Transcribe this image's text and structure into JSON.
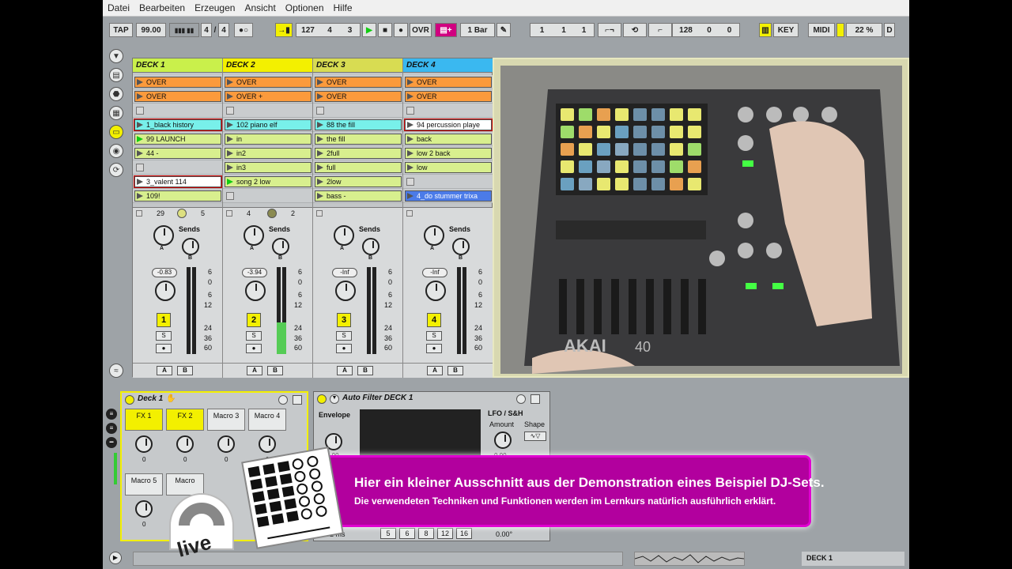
{
  "menu": [
    "Datei",
    "Bearbeiten",
    "Erzeugen",
    "Ansicht",
    "Optionen",
    "Hilfe"
  ],
  "control_bar": {
    "tap": "TAP",
    "tempo": "99.00",
    "signature_num": "4",
    "signature_den": "4",
    "position_bar": "127",
    "position_beat": "4",
    "position_sixteenth": "3",
    "ovr": "OVR",
    "quantize": "1 Bar",
    "loop_start_bar": "1",
    "loop_start_beat": "1",
    "loop_start_sixteenth": "1",
    "loop_len_bar": "128",
    "loop_len_beat": "0",
    "loop_len_sixteenth": "0",
    "key": "KEY",
    "midi": "MIDI",
    "cpu": "22 %",
    "d": "D"
  },
  "tracks": [
    {
      "name": "DECK 1",
      "color": "#c9f04b",
      "volume": "-0.83",
      "number": "1",
      "send_a": "29",
      "send_b": "5",
      "clips": [
        {
          "label": "OVER",
          "type": "orange"
        },
        {
          "label": "OVER",
          "type": "orange"
        },
        {
          "label": "",
          "type": "stop"
        },
        {
          "label": "1_black history",
          "type": "cyan"
        },
        {
          "label": "99 LAUNCH",
          "type": "green",
          "playing": true
        },
        {
          "label": "44 -",
          "type": "green"
        },
        {
          "label": "",
          "type": "stop"
        },
        {
          "label": "3_valent 114",
          "type": "white"
        },
        {
          "label": "109!",
          "type": "green"
        }
      ]
    },
    {
      "name": "DECK 2",
      "color": "#f3f000",
      "volume": "-3.94",
      "number": "2",
      "send_a": "4",
      "send_b": "2",
      "clips": [
        {
          "label": "OVER",
          "type": "orange"
        },
        {
          "label": "OVER +",
          "type": "orange"
        },
        {
          "label": "",
          "type": "stop"
        },
        {
          "label": "102 piano elf",
          "type": "cyan"
        },
        {
          "label": "in",
          "type": "green"
        },
        {
          "label": "in2",
          "type": "green"
        },
        {
          "label": "in3",
          "type": "green"
        },
        {
          "label": "song 2 low",
          "type": "green",
          "playing": true
        },
        {
          "label": "",
          "type": "stop"
        }
      ]
    },
    {
      "name": "DECK 3",
      "color": "#d8dc52",
      "volume": "-Inf",
      "number": "3",
      "send_a": "",
      "send_b": "",
      "clips": [
        {
          "label": "OVER",
          "type": "orange"
        },
        {
          "label": "OVER",
          "type": "orange"
        },
        {
          "label": "",
          "type": "stop"
        },
        {
          "label": "88 the fill",
          "type": "cyan"
        },
        {
          "label": "the fill",
          "type": "green"
        },
        {
          "label": "2full",
          "type": "green"
        },
        {
          "label": "full",
          "type": "green"
        },
        {
          "label": "2low",
          "type": "green"
        },
        {
          "label": "bass -",
          "type": "green"
        }
      ]
    },
    {
      "name": "DECK 4",
      "color": "#3ab8f0",
      "volume": "-Inf",
      "number": "4",
      "send_a": "",
      "send_b": "",
      "clips": [
        {
          "label": "OVER",
          "type": "orange"
        },
        {
          "label": "OVER",
          "type": "orange"
        },
        {
          "label": "",
          "type": "stop"
        },
        {
          "label": "94 percussion playe",
          "type": "white"
        },
        {
          "label": "back",
          "type": "green"
        },
        {
          "label": "low 2 back",
          "type": "green"
        },
        {
          "label": "low",
          "type": "green"
        },
        {
          "label": "",
          "type": "stop"
        },
        {
          "label": "4_do stummer trixa",
          "type": "blue"
        }
      ]
    }
  ],
  "mixer_labels": {
    "sends": "Sends",
    "a": "A",
    "b": "B",
    "solo": "S",
    "scale": [
      "6",
      "0",
      "6",
      "12",
      "24",
      "36",
      "60"
    ],
    "scale_top": [
      "6",
      "0"
    ],
    "scale_mid": [
      "6",
      "12"
    ],
    "scale_low": [
      "24",
      "36",
      "60"
    ]
  },
  "rack": {
    "title": "Deck 1",
    "macros": [
      {
        "label": "FX 1",
        "value": "0",
        "active": true
      },
      {
        "label": "FX 2",
        "value": "0",
        "active": true
      },
      {
        "label": "Macro 3",
        "value": "0",
        "active": false
      },
      {
        "label": "Macro 4",
        "value": "0",
        "active": false
      },
      {
        "label": "Macro 5",
        "value": "0",
        "active": false
      },
      {
        "label": "Macro",
        "value": "",
        "active": false
      }
    ]
  },
  "filter": {
    "title": "Auto Filter DECK 1",
    "envelope": "Envelope",
    "lfo": "LFO / S&H",
    "amount": "Amount",
    "shape": "Shape",
    "env_val": "0.00",
    "amount_val": "0.00",
    "release": "102 ms",
    "steps": [
      "5",
      "6",
      "8",
      "12",
      "16"
    ],
    "phase": "0.00°"
  },
  "banner": {
    "line1": "Hier ein kleiner Ausschnitt aus der Demonstration eines Beispiel DJ-Sets.",
    "line2": "Die verwendeten Techniken und Funktionen werden im Lernkurs natürlich ausführlich erklärt."
  },
  "logo": {
    "text": "live"
  },
  "video": {
    "brand": "AKAI",
    "model": "40"
  },
  "status": {
    "track": "DECK 1"
  },
  "colors": {
    "orange": "#fb9a3c",
    "green": "#d8ef8e",
    "cyan": "#78f0ea",
    "white": "#ffffff",
    "blue": "#4b7be8",
    "yellow": "#f3f000",
    "magenta": "#b2009e"
  }
}
